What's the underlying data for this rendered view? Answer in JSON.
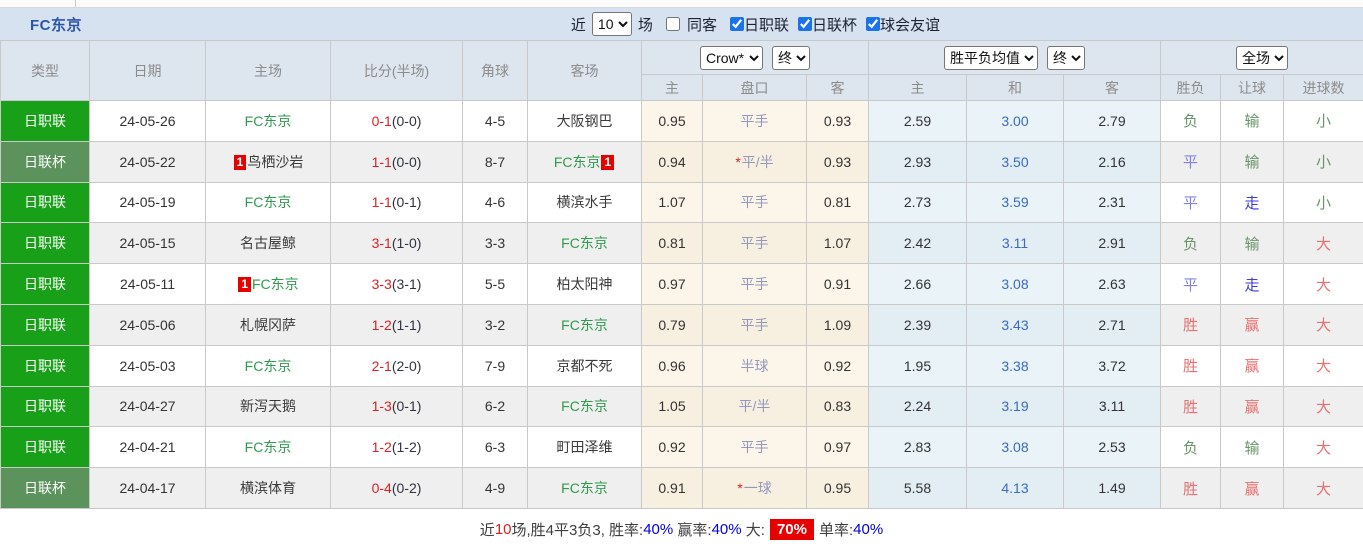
{
  "title": "FC东京",
  "toolbar": {
    "recent_label": "近",
    "recent_count": "10",
    "games_label": "场",
    "same_opponent": {
      "label": "同客",
      "checked": false
    },
    "filters": [
      {
        "label": "日职联",
        "checked": true
      },
      {
        "label": "日联杯",
        "checked": true
      },
      {
        "label": "球会友谊",
        "checked": true
      }
    ]
  },
  "table": {
    "headers": {
      "type": "类型",
      "date": "日期",
      "home": "主场",
      "score": "比分(半场)",
      "corner": "角球",
      "away": "客场",
      "odds_group": {
        "company_select": "Crow*",
        "time_select": "终",
        "home": "主",
        "handicap": "盘口",
        "away": "客"
      },
      "avg_group": {
        "metric_select": "胜平负均值",
        "time_select": "终",
        "home": "主",
        "draw": "和",
        "away": "客"
      },
      "result_group": {
        "scope_select": "全场",
        "outcome": "胜负",
        "handicap": "让球",
        "goals": "进球数"
      }
    },
    "rows": [
      {
        "type": "日职联",
        "type_class": "league",
        "date": "24-05-26",
        "home": {
          "name": "FC东京",
          "fc": true,
          "badge": null,
          "badge_pos": null
        },
        "score_ft": "0-1",
        "score_ht": "(0-0)",
        "corner": "4-5",
        "away": {
          "name": "大阪钢巴",
          "fc": false,
          "badge": null,
          "badge_pos": null
        },
        "odds": {
          "home": "0.95",
          "handicap": "平手",
          "star": false,
          "away": "0.93"
        },
        "avg": {
          "home": "2.59",
          "draw": "3.00",
          "away": "2.79"
        },
        "result": {
          "outcome": "负",
          "handicap": "输",
          "goals": "小"
        }
      },
      {
        "type": "日联杯",
        "type_class": "cup",
        "date": "24-05-22",
        "home": {
          "name": "鸟栖沙岩",
          "fc": false,
          "badge": "1",
          "badge_pos": "before"
        },
        "score_ft": "1-1",
        "score_ht": "(0-0)",
        "corner": "8-7",
        "away": {
          "name": "FC东京",
          "fc": true,
          "badge": "1",
          "badge_pos": "after"
        },
        "odds": {
          "home": "0.94",
          "handicap": "平/半",
          "star": true,
          "away": "0.93"
        },
        "avg": {
          "home": "2.93",
          "draw": "3.50",
          "away": "2.16"
        },
        "result": {
          "outcome": "平",
          "handicap": "输",
          "goals": "小"
        }
      },
      {
        "type": "日职联",
        "type_class": "league",
        "date": "24-05-19",
        "home": {
          "name": "FC东京",
          "fc": true,
          "badge": null,
          "badge_pos": null
        },
        "score_ft": "1-1",
        "score_ht": "(0-1)",
        "corner": "4-6",
        "away": {
          "name": "横滨水手",
          "fc": false,
          "badge": null,
          "badge_pos": null
        },
        "odds": {
          "home": "1.07",
          "handicap": "平手",
          "star": false,
          "away": "0.81"
        },
        "avg": {
          "home": "2.73",
          "draw": "3.59",
          "away": "2.31"
        },
        "result": {
          "outcome": "平",
          "handicap": "走",
          "goals": "小"
        }
      },
      {
        "type": "日职联",
        "type_class": "league",
        "date": "24-05-15",
        "home": {
          "name": "名古屋鲸",
          "fc": false,
          "badge": null,
          "badge_pos": null
        },
        "score_ft": "3-1",
        "score_ht": "(1-0)",
        "corner": "3-3",
        "away": {
          "name": "FC东京",
          "fc": true,
          "badge": null,
          "badge_pos": null
        },
        "odds": {
          "home": "0.81",
          "handicap": "平手",
          "star": false,
          "away": "1.07"
        },
        "avg": {
          "home": "2.42",
          "draw": "3.11",
          "away": "2.91"
        },
        "result": {
          "outcome": "负",
          "handicap": "输",
          "goals": "大"
        }
      },
      {
        "type": "日职联",
        "type_class": "league",
        "date": "24-05-11",
        "home": {
          "name": "FC东京",
          "fc": true,
          "badge": "1",
          "badge_pos": "before"
        },
        "score_ft": "3-3",
        "score_ht": "(3-1)",
        "corner": "5-5",
        "away": {
          "name": "柏太阳神",
          "fc": false,
          "badge": null,
          "badge_pos": null
        },
        "odds": {
          "home": "0.97",
          "handicap": "平手",
          "star": false,
          "away": "0.91"
        },
        "avg": {
          "home": "2.66",
          "draw": "3.08",
          "away": "2.63"
        },
        "result": {
          "outcome": "平",
          "handicap": "走",
          "goals": "大"
        }
      },
      {
        "type": "日职联",
        "type_class": "league",
        "date": "24-05-06",
        "home": {
          "name": "札幌冈萨",
          "fc": false,
          "badge": null,
          "badge_pos": null
        },
        "score_ft": "1-2",
        "score_ht": "(1-1)",
        "corner": "3-2",
        "away": {
          "name": "FC东京",
          "fc": true,
          "badge": null,
          "badge_pos": null
        },
        "odds": {
          "home": "0.79",
          "handicap": "平手",
          "star": false,
          "away": "1.09"
        },
        "avg": {
          "home": "2.39",
          "draw": "3.43",
          "away": "2.71"
        },
        "result": {
          "outcome": "胜",
          "handicap": "赢",
          "goals": "大"
        }
      },
      {
        "type": "日职联",
        "type_class": "league",
        "date": "24-05-03",
        "home": {
          "name": "FC东京",
          "fc": true,
          "badge": null,
          "badge_pos": null
        },
        "score_ft": "2-1",
        "score_ht": "(2-0)",
        "corner": "7-9",
        "away": {
          "name": "京都不死",
          "fc": false,
          "badge": null,
          "badge_pos": null
        },
        "odds": {
          "home": "0.96",
          "handicap": "半球",
          "star": false,
          "away": "0.92"
        },
        "avg": {
          "home": "1.95",
          "draw": "3.38",
          "away": "3.72"
        },
        "result": {
          "outcome": "胜",
          "handicap": "赢",
          "goals": "大"
        }
      },
      {
        "type": "日职联",
        "type_class": "league",
        "date": "24-04-27",
        "home": {
          "name": "新泻天鹅",
          "fc": false,
          "badge": null,
          "badge_pos": null
        },
        "score_ft": "1-3",
        "score_ht": "(0-1)",
        "corner": "6-2",
        "away": {
          "name": "FC东京",
          "fc": true,
          "badge": null,
          "badge_pos": null
        },
        "odds": {
          "home": "1.05",
          "handicap": "平/半",
          "star": false,
          "away": "0.83"
        },
        "avg": {
          "home": "2.24",
          "draw": "3.19",
          "away": "3.11"
        },
        "result": {
          "outcome": "胜",
          "handicap": "赢",
          "goals": "大"
        }
      },
      {
        "type": "日职联",
        "type_class": "league",
        "date": "24-04-21",
        "home": {
          "name": "FC东京",
          "fc": true,
          "badge": null,
          "badge_pos": null
        },
        "score_ft": "1-2",
        "score_ht": "(1-2)",
        "corner": "6-3",
        "away": {
          "name": "町田泽维",
          "fc": false,
          "badge": null,
          "badge_pos": null
        },
        "odds": {
          "home": "0.92",
          "handicap": "平手",
          "star": false,
          "away": "0.97"
        },
        "avg": {
          "home": "2.83",
          "draw": "3.08",
          "away": "2.53"
        },
        "result": {
          "outcome": "负",
          "handicap": "输",
          "goals": "大"
        }
      },
      {
        "type": "日联杯",
        "type_class": "cup",
        "date": "24-04-17",
        "home": {
          "name": "横滨体育",
          "fc": false,
          "badge": null,
          "badge_pos": null
        },
        "score_ft": "0-4",
        "score_ht": "(0-2)",
        "corner": "4-9",
        "away": {
          "name": "FC东京",
          "fc": true,
          "badge": null,
          "badge_pos": null
        },
        "odds": {
          "home": "0.91",
          "handicap": "一球",
          "star": true,
          "away": "0.95"
        },
        "avg": {
          "home": "5.58",
          "draw": "4.13",
          "away": "1.49"
        },
        "result": {
          "outcome": "胜",
          "handicap": "赢",
          "goals": "大"
        }
      }
    ]
  },
  "summary": {
    "t1": "近",
    "count": "10",
    "t2": "场,胜4平3负3, 胜率:",
    "win_rate": "40%",
    "t3": " 赢率:",
    "odds_win_rate": "40%",
    "t4": " 大:",
    "big_rate": "70%",
    "t5": "单率:",
    "single_rate": "40%"
  },
  "colors": {
    "bar_bg": "#D6E2F0",
    "header_bg": "#DDE5EF",
    "title_blue": "#2A56A8",
    "league_green": "#18A018",
    "cup_green": "#5C935C",
    "fc_green": "#2E9B4E",
    "score_red": "#E02020",
    "badge_red": "#E60000",
    "handicap_slate": "#9598BC",
    "avg_blue": "#3A6BC0",
    "result_red": "#E87070",
    "result_green": "#6A936A",
    "draw_blue": "#8282E6",
    "walk_blue": "#3C3CE0",
    "link_blue": "#0000E0",
    "cream_odd": "#FCF6EA",
    "cream_even": "#F7F0E1",
    "ltblue_odd": "#EAF3F8",
    "ltblue_even": "#E3EDF4"
  }
}
